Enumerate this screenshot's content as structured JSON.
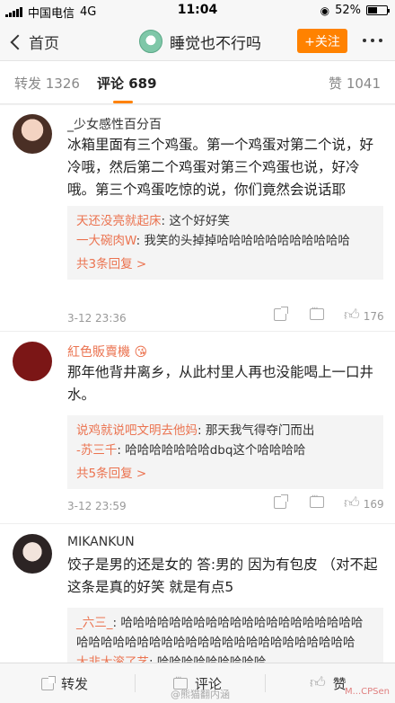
{
  "status_bar": {
    "carrier": "中国电信",
    "network": "4G",
    "time": "11:04",
    "battery": "52%",
    "battery_level": 0.52
  },
  "nav": {
    "back_label": "首页",
    "title": "睡觉也不行吗",
    "follow_label": "+关注"
  },
  "tabs": {
    "repost": "转发 1326",
    "comments": "评论 689",
    "likes": "赞 1041"
  },
  "comments": [
    {
      "name": "_少女感性百分百",
      "text": "冰箱里面有三个鸡蛋。第一个鸡蛋对第二个说，好冷哦，然后第二个鸡蛋对第三个鸡蛋也说，好冷哦。第三个鸡蛋吃惊的说，你们竟然会说话耶",
      "replies": [
        {
          "who": "天还没亮就起床",
          "text": ": 这个好好笑"
        },
        {
          "who": "一大碗肉W",
          "text": ": 我笑的头掉掉哈哈哈哈哈哈哈哈哈哈哈"
        }
      ],
      "more_replies": "共3条回复 >",
      "time": "3-12 23:36",
      "likes": "176"
    },
    {
      "name": "紅色販賣機",
      "text": "那年他背井离乡，从此村里人再也没能喝上一口井水。",
      "replies": [
        {
          "who": "说鸡就说吧文明去他妈",
          "text": ": 那天我气得夺门而出"
        },
        {
          "who": "-苏三千",
          "text": ": 哈哈哈哈哈哈哈dbq这个哈哈哈哈"
        }
      ],
      "more_replies": "共5条回复 >",
      "time": "3-12 23:59",
      "likes": "169"
    },
    {
      "name": "MIKANKUN",
      "text": "饺子是男的还是女的 答:男的 因为有包皮 （对不起这条是真的好笑 就是有点5",
      "replies": [
        {
          "who": "_六三_",
          "text": ": 哈哈哈哈哈哈哈哈哈哈哈哈哈哈哈哈哈哈哈哈哈哈哈哈哈哈哈哈哈哈哈哈哈哈哈哈哈哈哈哈哈哈哈"
        },
        {
          "who": "大非大滚了艺",
          "text": ": 哈哈哈哈哈哈哈哈哈"
        }
      ]
    }
  ],
  "bottom_bar": {
    "repost": "转发",
    "comment": "评论",
    "like": "赞",
    "watermark": "@熊猫翻内涵",
    "watermark2": "M...CPSen"
  }
}
